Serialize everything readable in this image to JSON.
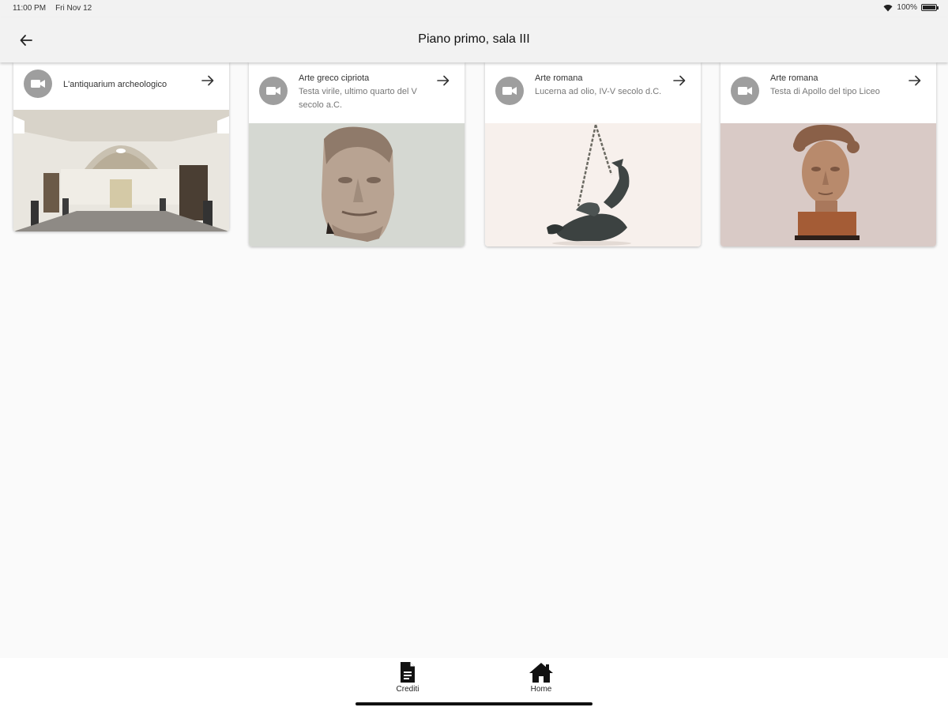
{
  "status_bar": {
    "time": "11:00 PM",
    "date": "Fri Nov 12",
    "battery": "100%"
  },
  "header": {
    "title": "Piano primo, sala III",
    "back_icon": "arrow-left-icon"
  },
  "cards": [
    {
      "title": "L'antiquarium archeologico",
      "subtitle": "",
      "icon": "video-camera-icon",
      "image": "museum-hall-photo",
      "image_bg": "#d8d5cf"
    },
    {
      "title": "Arte greco cipriota",
      "subtitle": "Testa virile, ultimo quarto del V secolo a.C.",
      "icon": "video-camera-icon",
      "image": "male-head-sculpture-photo",
      "image_bg": "#d5d8d2"
    },
    {
      "title": "Arte romana",
      "subtitle": "Lucerna ad olio, IV-V secolo d.C.",
      "icon": "video-camera-icon",
      "image": "oil-lamp-photo",
      "image_bg": "#f7f0ec"
    },
    {
      "title": "Arte romana",
      "subtitle": "Testa di Apollo del tipo Liceo",
      "icon": "video-camera-icon",
      "image": "apollo-head-photo",
      "image_bg": "#d9cac6"
    }
  ],
  "bottom_nav": [
    {
      "label": "Crediti",
      "icon": "document-icon"
    },
    {
      "label": "Home",
      "icon": "home-icon"
    }
  ]
}
